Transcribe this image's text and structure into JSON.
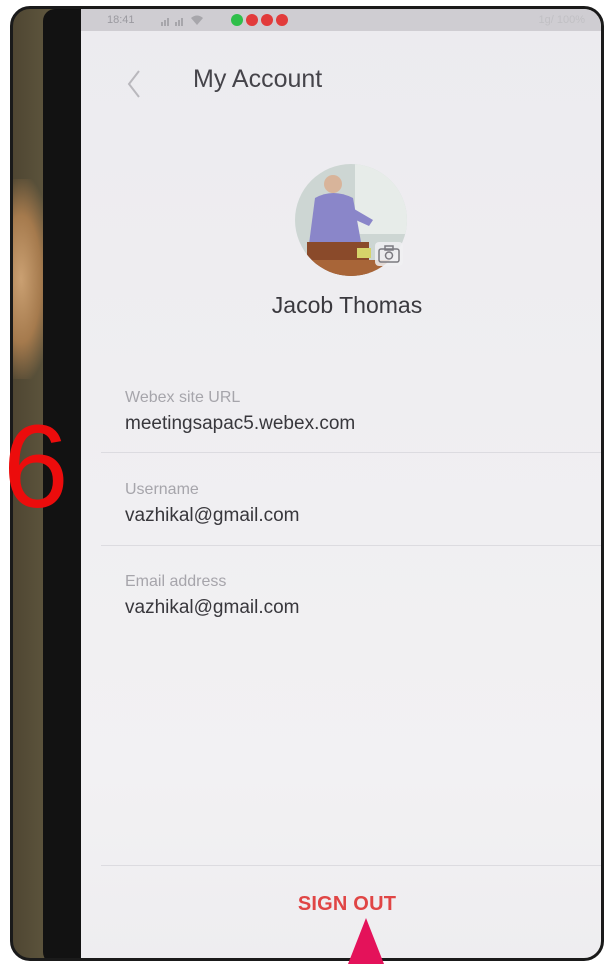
{
  "status_bar": {
    "time": "18:41",
    "right_text": "1g/ 100%",
    "notification_colors": [
      "#2fbf4a",
      "#e23b3b",
      "#e23b3b",
      "#e23b3b"
    ]
  },
  "header": {
    "back_icon": "chevron-left-icon",
    "title": "My Account"
  },
  "profile": {
    "name": "Jacob Thomas",
    "camera_icon": "camera-icon"
  },
  "fields": [
    {
      "label": "Webex site URL",
      "value": "meetingsapac5.webex.com"
    },
    {
      "label": "Username",
      "value": "vazhikal@gmail.com"
    },
    {
      "label": "Email address",
      "value": "vazhikal@gmail.com"
    }
  ],
  "actions": {
    "sign_out_label": "SIGN OUT"
  },
  "annotation": {
    "step_number": "6",
    "step_color": "#ec0c0c",
    "arrow_color": "#e4125a"
  },
  "colors": {
    "accent": "#e04545",
    "screen_bg": "#efeef1"
  }
}
